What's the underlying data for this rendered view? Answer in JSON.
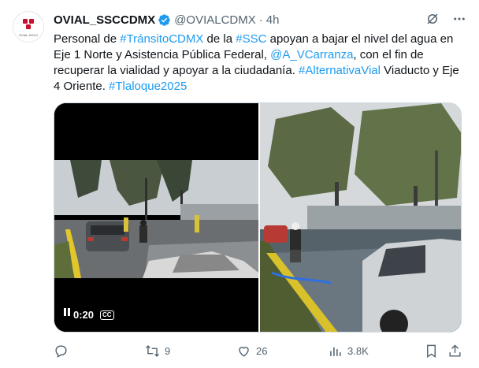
{
  "author": {
    "name": "OVIAL_SSCCDMX",
    "handle": "@OVIALCDMX",
    "dot": "·",
    "time": "4h",
    "avatar_caption": "OVIAL DGCV"
  },
  "tweet": {
    "t1": "Personal de ",
    "h1": "#TránsitoCDMX",
    "t2": " de la ",
    "h2": "#SSC",
    "t3": " apoyan a bajar el nivel del agua en Eje 1 Norte y Asistencia Pública Federal, ",
    "m1": "@A_VCarranza",
    "t4": ", con el fin de recuperar la vialidad y apoyar a la ciudadanía. ",
    "h3": "#AlternativaVial",
    "t5": " Viaducto y Eje 4 Oriente. ",
    "h4": "#Tlaloque2025"
  },
  "video": {
    "time": "0:20",
    "cc_label": "CC"
  },
  "stats": {
    "retweets": "9",
    "likes": "26",
    "views": "3.8K"
  },
  "colors": {
    "link": "#1d9bf0",
    "verified": "#1d9bf0",
    "muted": "#536471"
  },
  "icons": [
    "verified-badge-icon",
    "grok-icon",
    "more-icon",
    "pause-icon",
    "reply-icon",
    "retweet-icon",
    "like-icon",
    "views-icon",
    "bookmark-icon",
    "share-icon"
  ]
}
